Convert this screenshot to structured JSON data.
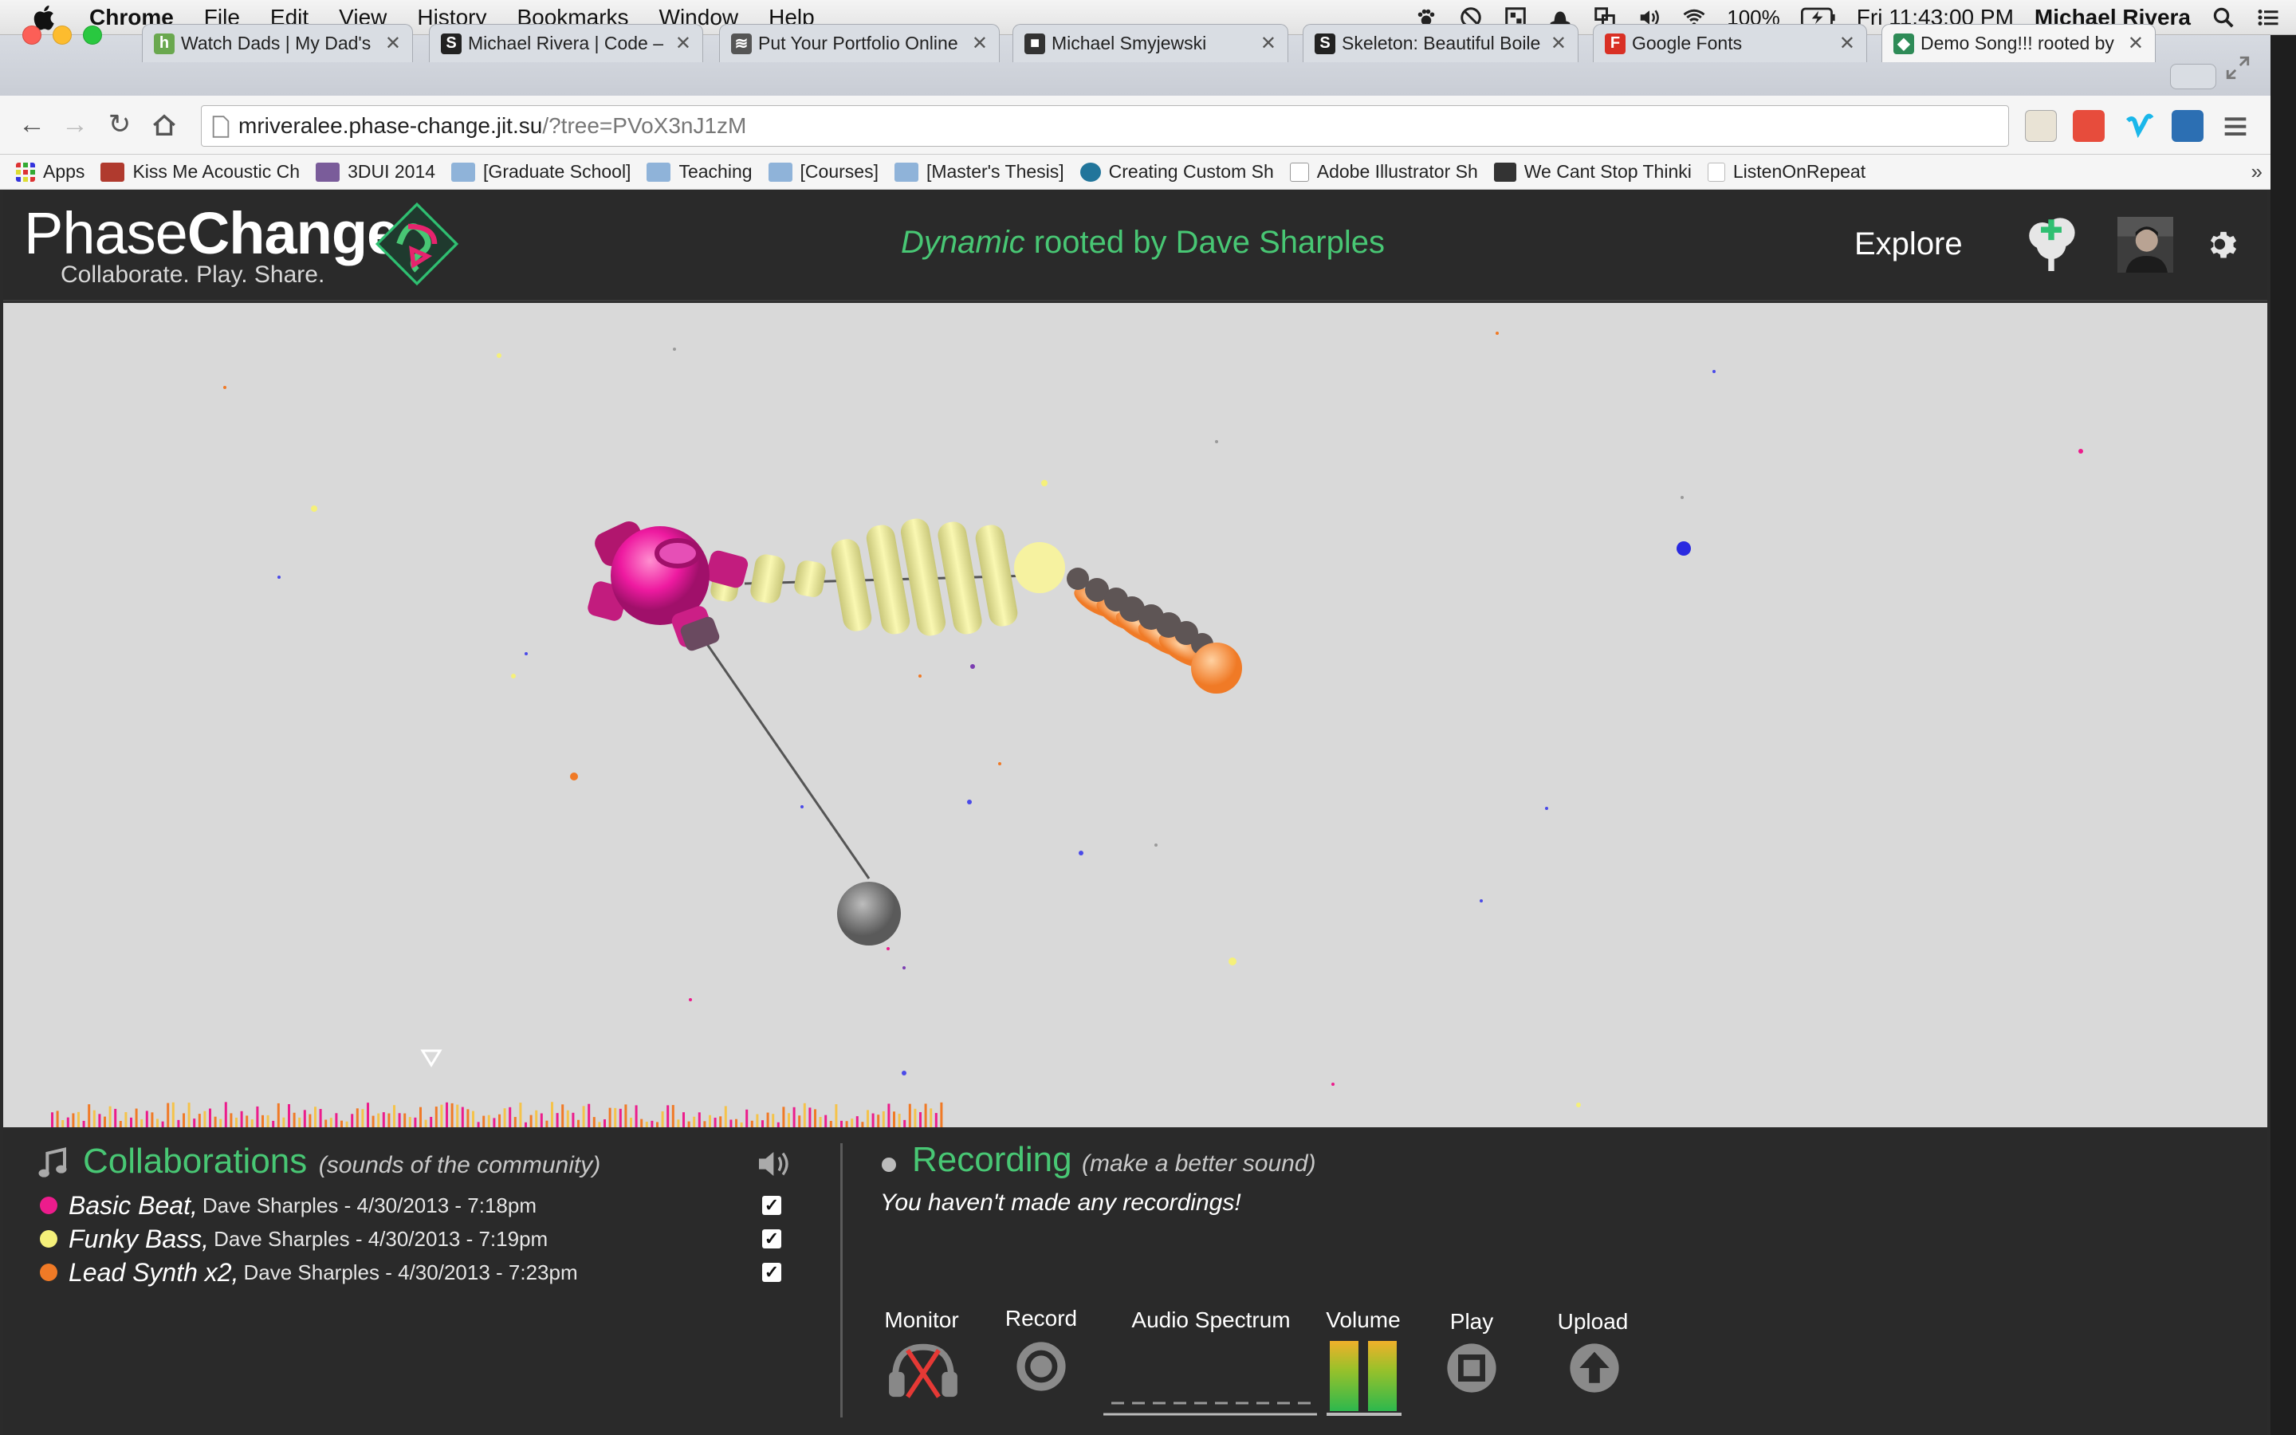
{
  "menubar": {
    "app": "Chrome",
    "items": [
      "File",
      "Edit",
      "View",
      "History",
      "Bookmarks",
      "Window",
      "Help"
    ],
    "battery": "100%",
    "clock": "Fri 11:43:00 PM",
    "user": "Michael Rivera"
  },
  "tabs": [
    {
      "title": "Watch Dads | My Dad's H",
      "favicon": "h",
      "color": "#6aa84f"
    },
    {
      "title": "Michael Rivera | Code –",
      "favicon": "S",
      "color": "#222222"
    },
    {
      "title": "Put Your Portfolio Online",
      "favicon": "≋",
      "color": "#444444"
    },
    {
      "title": "Michael Smyjewski",
      "favicon": "■",
      "color": "#333333"
    },
    {
      "title": "Skeleton: Beautiful Boile",
      "favicon": "S",
      "color": "#222222"
    },
    {
      "title": "Google Fonts",
      "favicon": "F",
      "color": "#d93025"
    },
    {
      "title": "Demo Song!!! rooted by",
      "favicon": "◆",
      "color": "#2e8b57"
    }
  ],
  "address": {
    "host": "mriveralee.phase-change.jit.su",
    "path": "/?tree=PVoX3nJ1zM"
  },
  "bookmarks": [
    "Apps",
    "Kiss Me Acoustic Ch",
    "3DUI 2014",
    "[Graduate School]",
    "Teaching",
    "[Courses]",
    "[Master's Thesis]",
    "Creating Custom Sh",
    "Adobe Illustrator Sh",
    "We Cant Stop Thinki",
    "ListenOnRepeat"
  ],
  "header": {
    "logo_light": "Phase",
    "logo_bold": "Change",
    "tagline": "Collaborate. Play. Share.",
    "title_em": "Dynamic",
    "title_rest": " rooted by Dave Sharples",
    "explore": "Explore"
  },
  "collaborations": {
    "title": "Collaborations",
    "subtitle": "(sounds of the community)",
    "items": [
      {
        "name": "Basic Beat,",
        "meta": "Dave Sharples - 4/30/2013 - 7:18pm",
        "color": "#ec1c8c",
        "checked": true
      },
      {
        "name": "Funky Bass,",
        "meta": "Dave Sharples - 4/30/2013 - 7:19pm",
        "color": "#f5f07a",
        "checked": true
      },
      {
        "name": "Lead Synth x2,",
        "meta": "Dave Sharples - 4/30/2013 - 7:23pm",
        "color": "#f07a26",
        "checked": true
      }
    ]
  },
  "recording": {
    "title": "Recording",
    "subtitle": "(make a better sound)",
    "empty": "You haven't made any recordings!",
    "controls": {
      "monitor": "Monitor",
      "record": "Record",
      "spectrum": "Audio Spectrum",
      "volume": "Volume",
      "play": "Play",
      "upload": "Upload"
    }
  },
  "colors": {
    "accent": "#48c774",
    "pink": "#ec1c8c",
    "yellow": "#f5f07a",
    "orange": "#f07a26"
  }
}
